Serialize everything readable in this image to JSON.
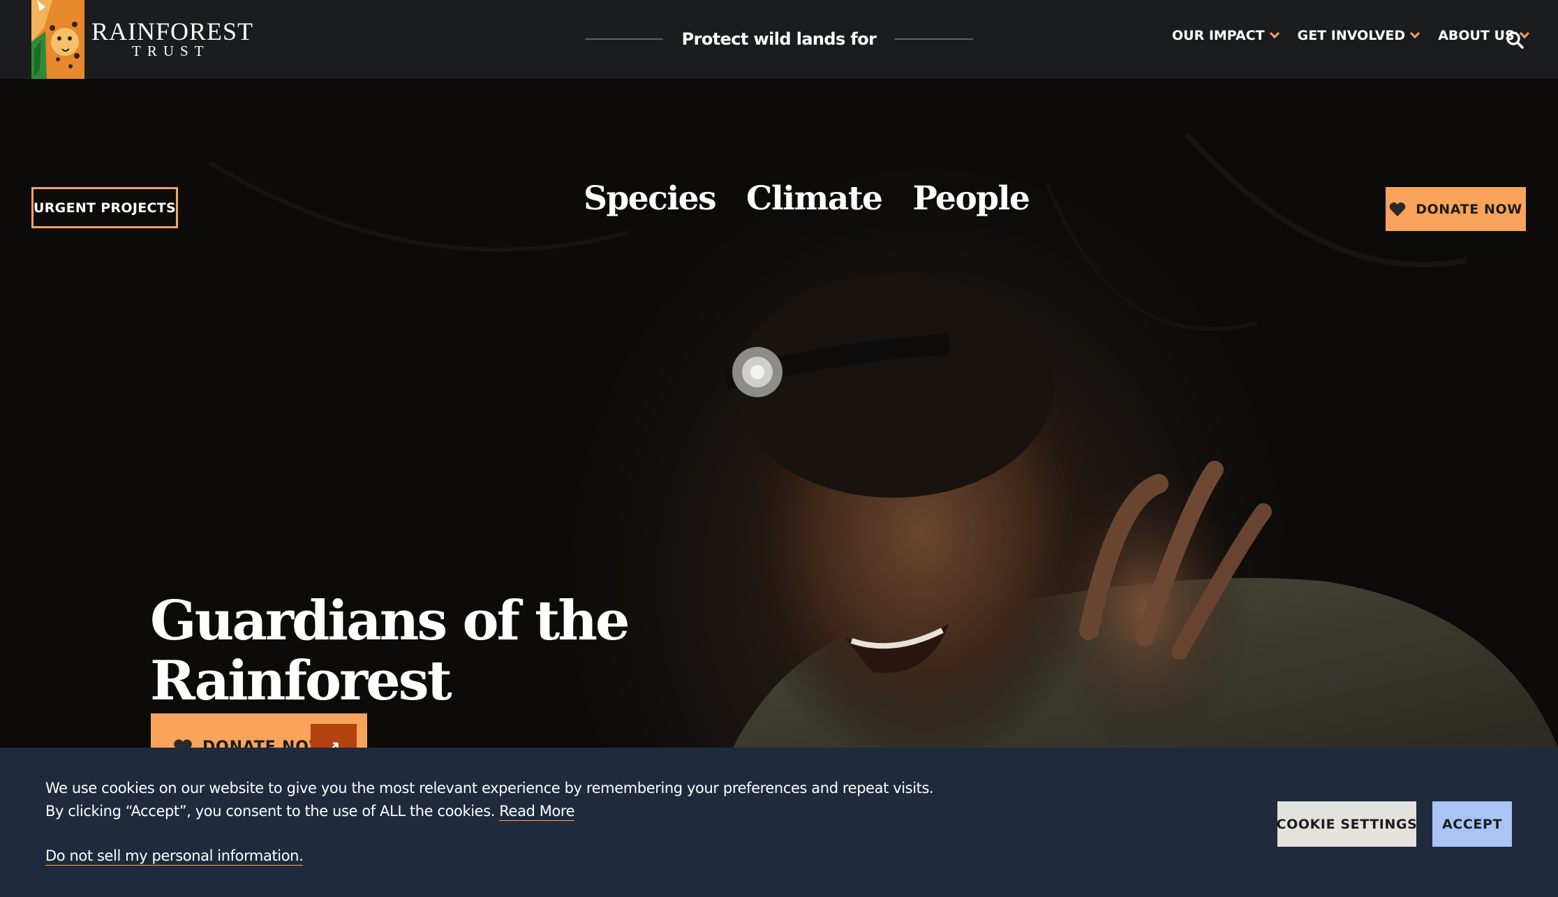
{
  "header": {
    "logo": {
      "name_line1": "RAINFOREST",
      "name_line2": "TRUST",
      "icon": "jaguar-logo-icon"
    },
    "tagline": "Protect wild lands for",
    "nav": [
      {
        "label": "OUR IMPACT"
      },
      {
        "label": "GET INVOLVED"
      },
      {
        "label": "ABOUT US"
      }
    ],
    "search_icon": "search-icon"
  },
  "hero": {
    "urgent_button": "URGENT PROJECTS",
    "topics": [
      "Species",
      "Climate",
      "People"
    ],
    "donate_top_label": "DONATE NOW",
    "headline": "Guardians of the Rainforest",
    "donate_label": "DONATE NOW",
    "donate_arrow": "↗"
  },
  "cookie_banner": {
    "text": "We use cookies on our website to give you the most relevant experience by remembering your preferences and repeat visits. By clicking “Accept”, you consent to the use of ALL the cookies.",
    "read_more": "Read More",
    "do_not_sell": "Do not sell my personal information.",
    "settings_label": "COOKIE SETTINGS",
    "accept_label": "ACCEPT"
  },
  "colors": {
    "accent_orange": "#f9a35b",
    "arrow_box": "#b3430f",
    "topbar_bg": "#1b1c1e",
    "cookie_bg": "#1f2a3d",
    "accept_bg": "#a9c4f5",
    "settings_bg": "#e4e2de"
  }
}
